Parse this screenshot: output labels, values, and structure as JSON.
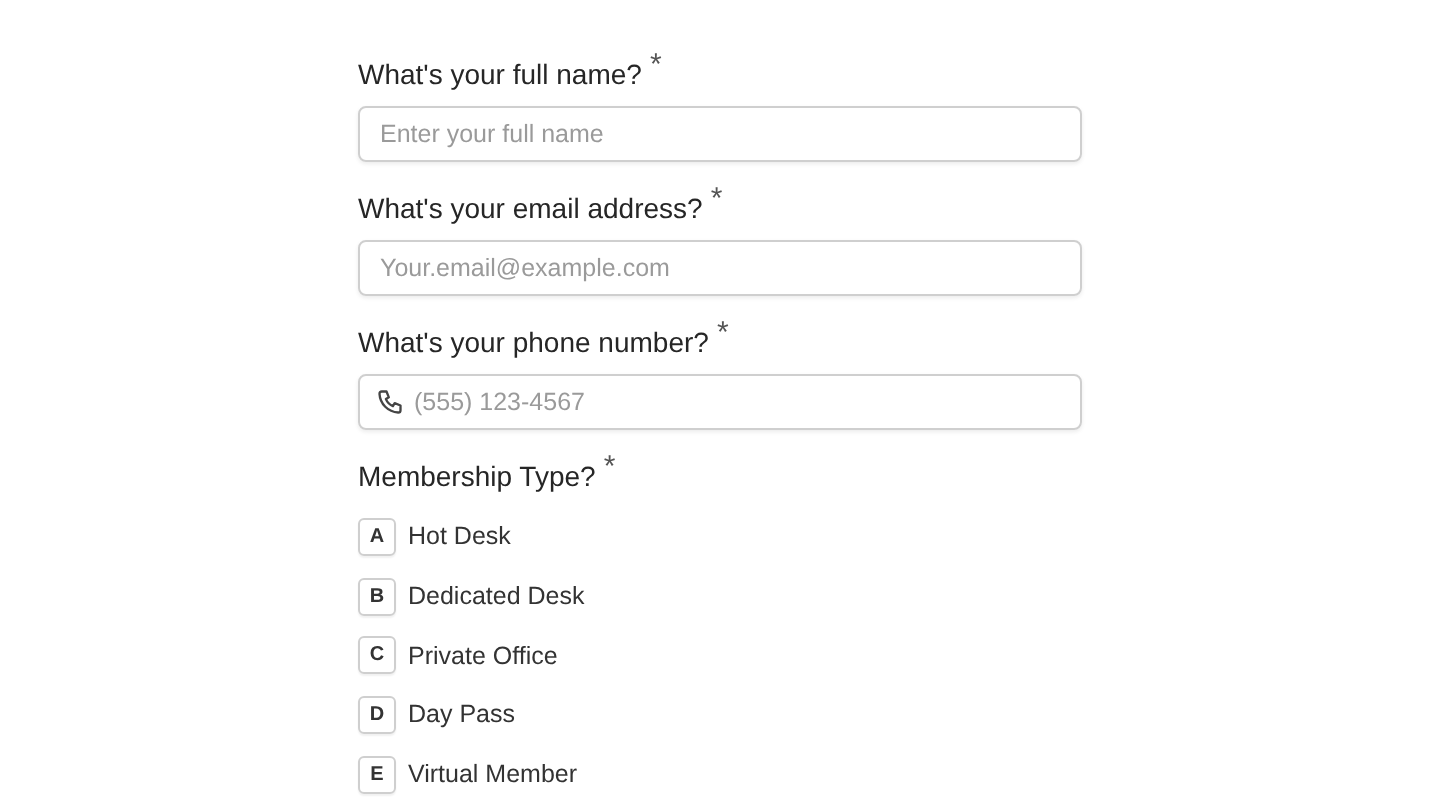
{
  "fields": [
    {
      "label": "What's your full name?",
      "required_mark": "*",
      "placeholder": "Enter your full name",
      "kind": "text"
    },
    {
      "label": "What's your email address?",
      "required_mark": "*",
      "placeholder": "Your.email@example.com",
      "kind": "text"
    },
    {
      "label": "What's your phone number?",
      "required_mark": "*",
      "placeholder": "(555) 123-4567",
      "kind": "phone"
    }
  ],
  "membership": {
    "label": "Membership Type?",
    "required_mark": "*",
    "options": [
      {
        "key": "A",
        "label": "Hot Desk",
        "selected": false
      },
      {
        "key": "B",
        "label": "Dedicated Desk",
        "selected": false
      },
      {
        "key": "C",
        "label": "Private Office",
        "selected": false
      },
      {
        "key": "D",
        "label": "Day Pass",
        "selected": false
      },
      {
        "key": "E",
        "label": "Virtual Member",
        "selected": false
      }
    ]
  }
}
